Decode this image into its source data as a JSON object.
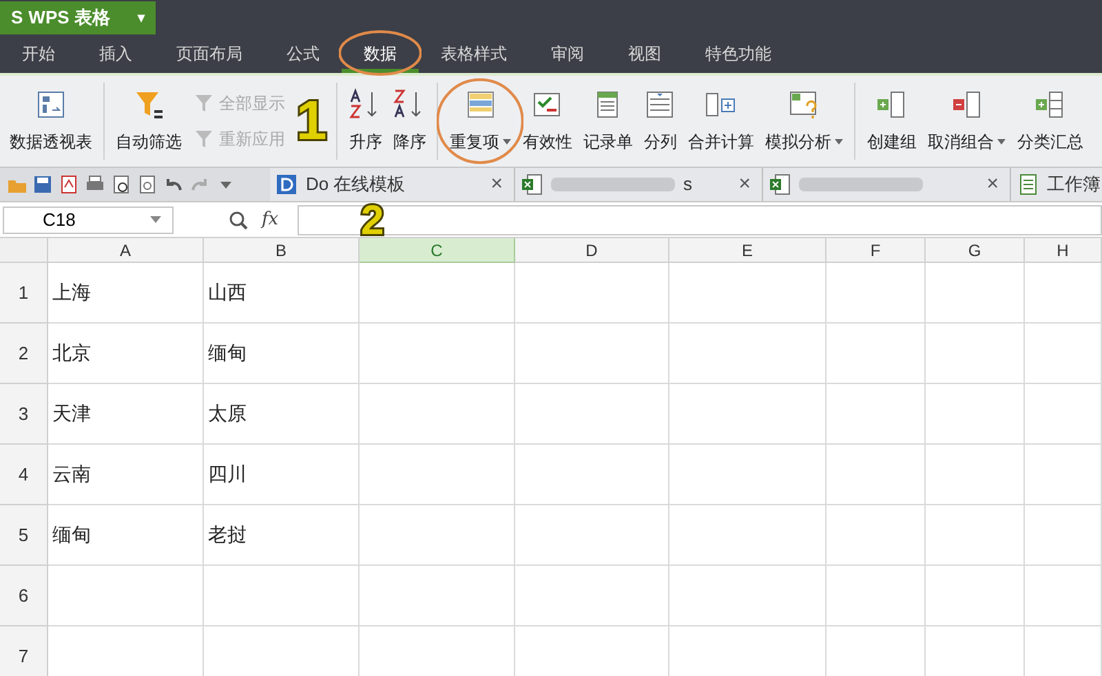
{
  "app_button": {
    "logo": "S",
    "label": "WPS 表格",
    "caret": "▾"
  },
  "menu": [
    {
      "label": "开始",
      "selected": false
    },
    {
      "label": "插入",
      "selected": false
    },
    {
      "label": "页面布局",
      "selected": false
    },
    {
      "label": "公式",
      "selected": false
    },
    {
      "label": "数据",
      "selected": true
    },
    {
      "label": "表格样式",
      "selected": false
    },
    {
      "label": "审阅",
      "selected": false
    },
    {
      "label": "视图",
      "selected": false
    },
    {
      "label": "特色功能",
      "selected": false
    }
  ],
  "ribbon": [
    {
      "kind": "big",
      "label": "数据透视表",
      "dropdown": false
    },
    {
      "kind": "sep"
    },
    {
      "kind": "big",
      "label": "自动筛选",
      "dropdown": false
    },
    {
      "kind": "pair",
      "items": [
        {
          "label": "全部显示",
          "disabled": true
        },
        {
          "label": "重新应用",
          "disabled": true
        }
      ]
    },
    {
      "kind": "sep"
    },
    {
      "kind": "big",
      "label": "升序",
      "dropdown": false
    },
    {
      "kind": "big",
      "label": "降序",
      "dropdown": false
    },
    {
      "kind": "sep"
    },
    {
      "kind": "big",
      "label": "重复项",
      "dropdown": true
    },
    {
      "kind": "big",
      "label": "有效性",
      "dropdown": false
    },
    {
      "kind": "big",
      "label": "记录单",
      "dropdown": false
    },
    {
      "kind": "big",
      "label": "分列",
      "dropdown": false
    },
    {
      "kind": "big",
      "label": "合并计算",
      "dropdown": false
    },
    {
      "kind": "big",
      "label": "模拟分析",
      "dropdown": true
    },
    {
      "kind": "sep"
    },
    {
      "kind": "big",
      "label": "创建组",
      "dropdown": false
    },
    {
      "kind": "big",
      "label": "取消组合",
      "dropdown": true
    },
    {
      "kind": "big",
      "label": "分类汇总",
      "dropdown": false
    }
  ],
  "doc_tabs": [
    {
      "kind": "plain",
      "label": "Do    在线模板",
      "close": "×"
    },
    {
      "kind": "blurred",
      "label": "s",
      "close": "×"
    },
    {
      "kind": "blurred",
      "close": "×"
    },
    {
      "kind": "plain",
      "label": "工作簿"
    }
  ],
  "name_box": "C18",
  "fx": "fx",
  "columns": [
    {
      "label": "A",
      "selected": false
    },
    {
      "label": "B",
      "selected": false
    },
    {
      "label": "C",
      "selected": true
    },
    {
      "label": "D",
      "selected": false
    },
    {
      "label": "E",
      "selected": false
    },
    {
      "label": "F",
      "selected": false
    },
    {
      "label": "G",
      "selected": false
    },
    {
      "label": "H",
      "selected": false
    }
  ],
  "rows": [
    {
      "header": "1",
      "cells": [
        "上海",
        "山西"
      ]
    },
    {
      "header": "2",
      "cells": [
        "北京",
        "缅甸"
      ]
    },
    {
      "header": "3",
      "cells": [
        "天津",
        "太原"
      ]
    },
    {
      "header": "4",
      "cells": [
        "云南",
        "四川"
      ]
    },
    {
      "header": "5",
      "cells": [
        "缅甸",
        "老挝"
      ]
    },
    {
      "header": "6",
      "cells": []
    },
    {
      "header": "7",
      "cells": []
    }
  ],
  "annotations": [
    {
      "text": "1"
    },
    {
      "text": "2"
    }
  ]
}
